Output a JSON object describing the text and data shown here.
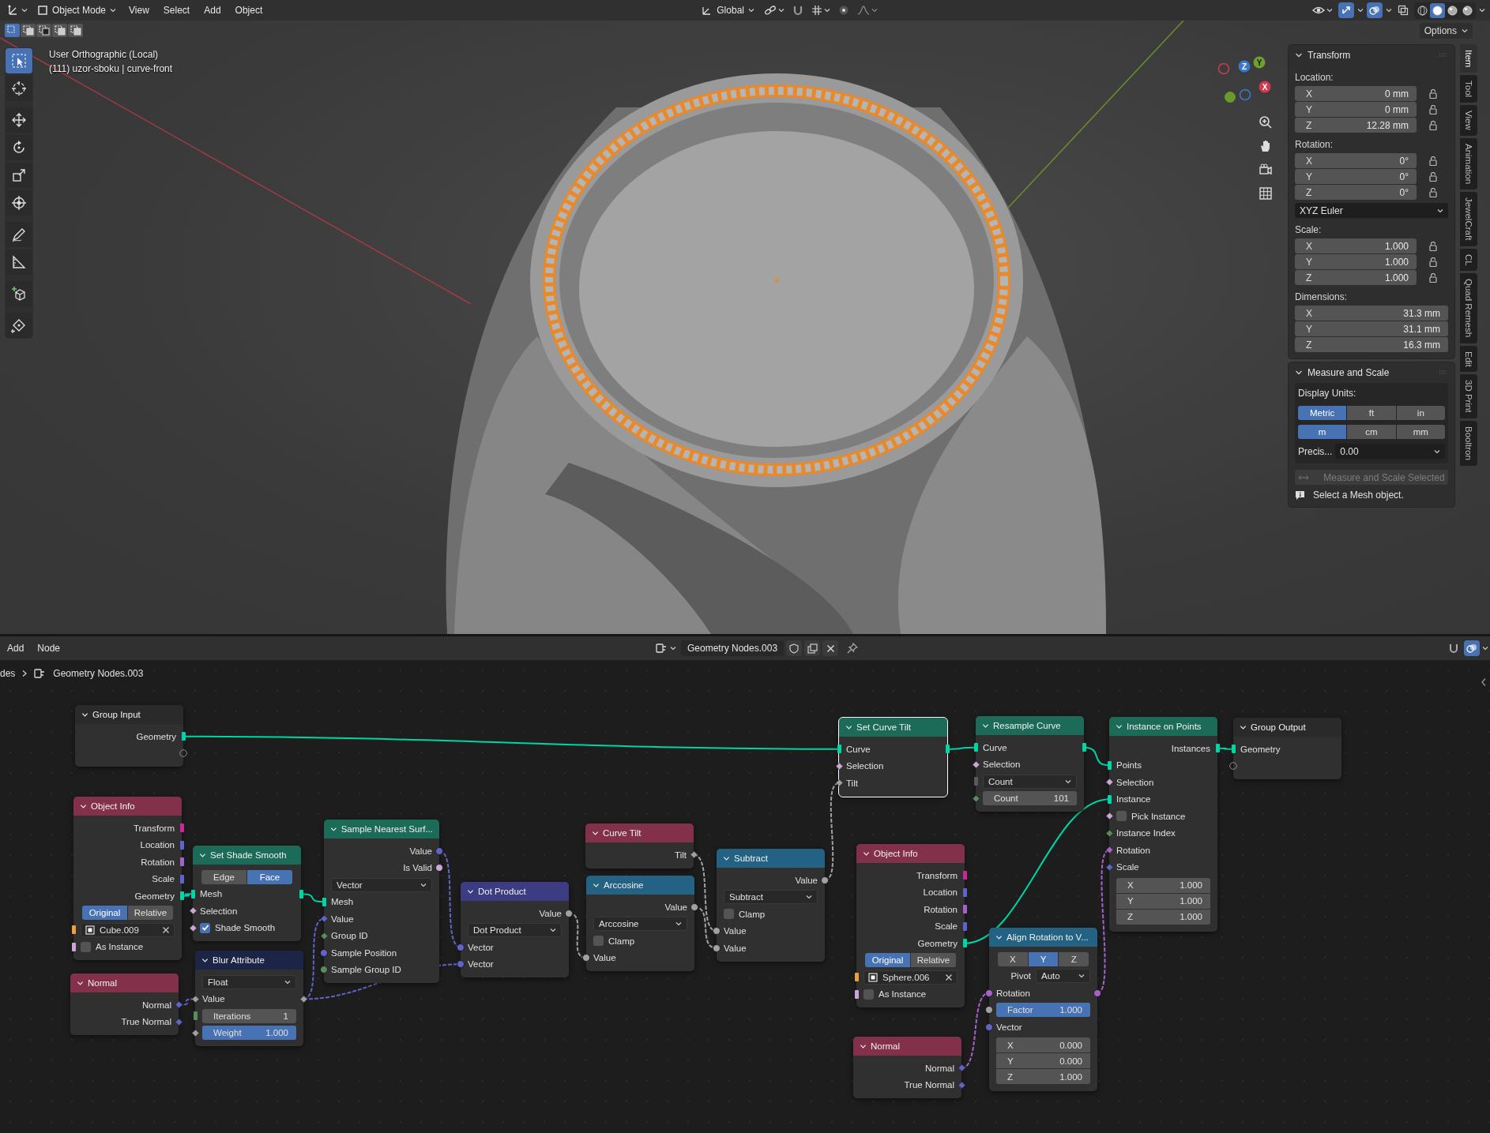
{
  "header": {
    "mode": "Object Mode",
    "menus": [
      "View",
      "Select",
      "Add",
      "Object"
    ],
    "orientation": "Global",
    "viewport_toggles": [
      {
        "kind": "gizmo",
        "on": true
      },
      {
        "kind": "overlay",
        "on": true
      },
      {
        "kind": "xray",
        "on": false
      }
    ],
    "shading": [
      {
        "kind": "wireframe",
        "selected": false
      },
      {
        "kind": "solid",
        "selected": true
      },
      {
        "kind": "material",
        "selected": false
      },
      {
        "kind": "rendered",
        "selected": false
      }
    ]
  },
  "viewport": {
    "select_modes": [
      {
        "kind": "set",
        "selected": true
      },
      {
        "kind": "extend",
        "selected": false
      },
      {
        "kind": "subtract",
        "selected": false
      },
      {
        "kind": "invert",
        "selected": false
      },
      {
        "kind": "intersect",
        "selected": false
      }
    ],
    "options": "Options",
    "view_name": "User Orthographic (Local)",
    "object_info": "(111) uzor-sboku | curve-front",
    "tools": [
      {
        "kind": "select",
        "selected": true
      },
      {
        "kind": "cursor",
        "selected": false
      },
      {
        "kind": "move",
        "selected": false
      },
      {
        "kind": "rotate",
        "selected": false
      },
      {
        "kind": "scale",
        "selected": false
      },
      {
        "kind": "transform",
        "selected": false
      },
      {
        "kind": "annotate",
        "selected": false
      },
      {
        "kind": "measure",
        "selected": false
      },
      {
        "kind": "add-cube",
        "selected": false
      },
      {
        "kind": "pen",
        "selected": false
      }
    ],
    "gizmo": {
      "x": "X",
      "y": "Y",
      "z": "Z"
    }
  },
  "sidebar": {
    "tabs": [
      {
        "label": "Item",
        "selected": true
      },
      {
        "label": "Tool",
        "selected": false
      },
      {
        "label": "View",
        "selected": false
      },
      {
        "label": "Animation",
        "selected": false
      },
      {
        "label": "JewelCraft",
        "selected": false
      },
      {
        "label": "CL",
        "selected": false
      },
      {
        "label": "Quad Remesh",
        "selected": false
      },
      {
        "label": "Edit",
        "selected": false
      },
      {
        "label": "3D Print",
        "selected": false
      },
      {
        "label": "Booltron",
        "selected": false
      }
    ],
    "transform": {
      "title": "Transform",
      "sections": [
        {
          "label": "Location:",
          "rows": [
            {
              "axis": "X",
              "value": "0 mm",
              "locked": false
            },
            {
              "axis": "Y",
              "value": "0 mm",
              "locked": false
            },
            {
              "axis": "Z",
              "value": "12.28 mm",
              "locked": false
            }
          ]
        },
        {
          "label": "Rotation:",
          "rows": [
            {
              "axis": "X",
              "value": "0°",
              "locked": false
            },
            {
              "axis": "Y",
              "value": "0°",
              "locked": false
            },
            {
              "axis": "Z",
              "value": "0°",
              "locked": false
            }
          ],
          "mode": "XYZ Euler"
        },
        {
          "label": "Scale:",
          "rows": [
            {
              "axis": "X",
              "value": "1.000",
              "locked": false
            },
            {
              "axis": "Y",
              "value": "1.000",
              "locked": false
            },
            {
              "axis": "Z",
              "value": "1.000",
              "locked": false
            }
          ]
        },
        {
          "label": "Dimensions:",
          "rows": [
            {
              "axis": "X",
              "value": "31.3 mm"
            },
            {
              "axis": "Y",
              "value": "31.1 mm"
            },
            {
              "axis": "Z",
              "value": "16.3 mm"
            }
          ]
        }
      ]
    },
    "measure": {
      "title": "Measure and Scale",
      "units_label": "Display Units:",
      "systems": [
        {
          "label": "Metric",
          "selected": true
        },
        {
          "label": "ft",
          "selected": false
        },
        {
          "label": "in",
          "selected": false
        }
      ],
      "units": [
        {
          "label": "m",
          "selected": true
        },
        {
          "label": "cm",
          "selected": false
        },
        {
          "label": "mm",
          "selected": false
        }
      ],
      "precision_label": "Precis...",
      "precision": "0.00",
      "button": {
        "label": "Measure and Scale Selected",
        "disabled": true
      },
      "message": "Select a Mesh object."
    }
  },
  "editor": {
    "menus": [
      "Add",
      "Node"
    ],
    "tree_name": "Geometry Nodes.003",
    "breadcrumb": [
      "des",
      "Geometry Nodes.003"
    ],
    "toggles": [
      {
        "kind": "snap",
        "on": false
      },
      {
        "kind": "overlay",
        "on": true
      }
    ],
    "nodes": [
      {
        "title": "Group Input",
        "color": "#2a2a2a",
        "selected": false,
        "rows": [
          {
            "kind": "out",
            "label": "Geometry",
            "socket": {
              "kind": "square",
              "color": "#00d6a3"
            }
          },
          {
            "kind": "virtual_out"
          }
        ]
      },
      {
        "title": "Object Info",
        "color": "#83314a",
        "selected": false,
        "rows": [
          {
            "kind": "out",
            "label": "Transform",
            "socket": {
              "kind": "square",
              "color": "#c7299b"
            }
          },
          {
            "kind": "out",
            "label": "Location",
            "socket": {
              "kind": "square",
              "color": "#6363c7"
            }
          },
          {
            "kind": "out",
            "label": "Rotation",
            "socket": {
              "kind": "square",
              "color": "#a663c7"
            }
          },
          {
            "kind": "out",
            "label": "Scale",
            "socket": {
              "kind": "square",
              "color": "#6363c7"
            }
          },
          {
            "kind": "out",
            "label": "Geometry",
            "socket": {
              "kind": "square",
              "color": "#00d6a3"
            }
          },
          {
            "kind": "toggle",
            "options": [
              {
                "label": "Original",
                "selected": true
              },
              {
                "label": "Relative",
                "selected": false
              }
            ]
          },
          {
            "kind": "object",
            "value": "Cube.009",
            "socket": {
              "kind": "square",
              "color": "#ed9e40"
            }
          },
          {
            "kind": "check",
            "label": "As Instance",
            "checked": false,
            "socket": {
              "kind": "square",
              "color": "#cca6d6"
            }
          }
        ]
      },
      {
        "title": "Normal",
        "color": "#83314a",
        "selected": false,
        "rows": [
          {
            "kind": "out",
            "label": "Normal",
            "socket": {
              "kind": "diamond",
              "color": "#6363c7"
            }
          },
          {
            "kind": "out",
            "label": "True Normal",
            "socket": {
              "kind": "diamond",
              "color": "#6363c7"
            }
          }
        ]
      },
      {
        "title": "Set Shade Smooth",
        "color": "#1b6b58",
        "selected": false,
        "rows": [
          {
            "kind": "toggle",
            "options": [
              {
                "label": "Edge",
                "selected": false
              },
              {
                "label": "Face",
                "selected": true
              }
            ]
          },
          {
            "kind": "inout",
            "label": "Mesh",
            "socket": {
              "kind": "square",
              "color": "#00d6a3"
            }
          },
          {
            "kind": "in",
            "label": "Selection",
            "socket": {
              "kind": "diamond",
              "color": "#cca6d6"
            }
          },
          {
            "kind": "check",
            "label": "Shade Smooth",
            "checked": true,
            "socket": {
              "kind": "diamond",
              "color": "#cca6d6"
            }
          }
        ]
      },
      {
        "title": "Blur Attribute",
        "color": "#1d2546",
        "selected": false,
        "rows": [
          {
            "kind": "dropdown",
            "value": "Float"
          },
          {
            "kind": "inout",
            "label": "Value",
            "socket": {
              "kind": "diamond",
              "color": "#a1a1a1"
            }
          },
          {
            "kind": "field",
            "label": "Iterations",
            "value": "1",
            "socket": {
              "kind": "square",
              "color": "#598c5c"
            }
          },
          {
            "kind": "field",
            "label": "Weight",
            "value": "1.000",
            "socket": {
              "kind": "diamond",
              "color": "#a1a1a1"
            },
            "level": 1
          }
        ]
      },
      {
        "title": "Sample Nearest Surf...",
        "color": "#1b6b58",
        "selected": false,
        "rows": [
          {
            "kind": "out",
            "label": "Value",
            "socket": {
              "kind": "dot",
              "color": "#6363c7"
            }
          },
          {
            "kind": "out",
            "label": "Is Valid",
            "socket": {
              "kind": "dot",
              "color": "#cca6d6"
            }
          },
          {
            "kind": "dropdown",
            "value": "Vector"
          },
          {
            "kind": "in",
            "label": "Mesh",
            "socket": {
              "kind": "square",
              "color": "#00d6a3"
            }
          },
          {
            "kind": "in",
            "label": "Value",
            "socket": {
              "kind": "diamond",
              "color": "#6363c7"
            }
          },
          {
            "kind": "in",
            "label": "Group ID",
            "socket": {
              "kind": "diamond",
              "color": "#598c5c"
            }
          },
          {
            "kind": "in",
            "label": "Sample Position",
            "socket": {
              "kind": "dot",
              "color": "#6363c7"
            }
          },
          {
            "kind": "in",
            "label": "Sample Group ID",
            "socket": {
              "kind": "dot",
              "color": "#598c5c"
            }
          }
        ]
      },
      {
        "title": "Dot Product",
        "color": "#3c3c83",
        "selected": false,
        "rows": [
          {
            "kind": "out",
            "label": "Value",
            "socket": {
              "kind": "dot",
              "color": "#a1a1a1"
            }
          },
          {
            "kind": "dropdown",
            "value": "Dot Product"
          },
          {
            "kind": "in",
            "label": "Vector",
            "socket": {
              "kind": "dot",
              "color": "#6363c7"
            }
          },
          {
            "kind": "in",
            "label": "Vector",
            "socket": {
              "kind": "dot",
              "color": "#6363c7"
            }
          }
        ]
      },
      {
        "title": "Curve Tilt",
        "color": "#83314a",
        "selected": false,
        "rows": [
          {
            "kind": "out",
            "label": "Tilt",
            "socket": {
              "kind": "diamond",
              "color": "#a1a1a1"
            }
          }
        ]
      },
      {
        "title": "Arccosine",
        "color": "#246283",
        "selected": false,
        "rows": [
          {
            "kind": "out",
            "label": "Value",
            "socket": {
              "kind": "dot",
              "color": "#a1a1a1"
            }
          },
          {
            "kind": "dropdown",
            "value": "Arccosine"
          },
          {
            "kind": "check",
            "label": "Clamp",
            "checked": false
          },
          {
            "kind": "in",
            "label": "Value",
            "socket": {
              "kind": "dot",
              "color": "#a1a1a1"
            }
          }
        ]
      },
      {
        "title": "Subtract",
        "color": "#246283",
        "selected": false,
        "rows": [
          {
            "kind": "out",
            "label": "Value",
            "socket": {
              "kind": "dot",
              "color": "#a1a1a1"
            }
          },
          {
            "kind": "dropdown",
            "value": "Subtract"
          },
          {
            "kind": "check",
            "label": "Clamp",
            "checked": false
          },
          {
            "kind": "in",
            "label": "Value",
            "socket": {
              "kind": "dot",
              "color": "#a1a1a1"
            }
          },
          {
            "kind": "in",
            "label": "Value",
            "socket": {
              "kind": "dot",
              "color": "#a1a1a1"
            }
          }
        ]
      },
      {
        "title": "Set Curve Tilt",
        "color": "#1b6b58",
        "selected": true,
        "rows": [
          {
            "kind": "inout",
            "label": "Curve",
            "socket": {
              "kind": "square",
              "color": "#00d6a3"
            }
          },
          {
            "kind": "in",
            "label": "Selection",
            "socket": {
              "kind": "diamond",
              "color": "#cca6d6"
            }
          },
          {
            "kind": "in",
            "label": "Tilt",
            "socket": {
              "kind": "diamond",
              "color": "#a1a1a1"
            }
          }
        ]
      },
      {
        "title": "Resample Curve",
        "color": "#1b6b58",
        "selected": false,
        "rows": [
          {
            "kind": "inout",
            "label": "Curve",
            "socket": {
              "kind": "square",
              "color": "#00d6a3"
            }
          },
          {
            "kind": "in",
            "label": "Selection",
            "socket": {
              "kind": "diamond",
              "color": "#cca6d6"
            }
          },
          {
            "kind": "dropdown",
            "value": "Count",
            "socket": {
              "kind": "square",
              "color": "#5a5a5a"
            }
          },
          {
            "kind": "field",
            "label": "Count",
            "value": "101",
            "socket": {
              "kind": "diamond",
              "color": "#598c5c"
            }
          }
        ]
      },
      {
        "title": "Instance on Points",
        "color": "#1b6b58",
        "selected": false,
        "rows": [
          {
            "kind": "out",
            "label": "Instances",
            "socket": {
              "kind": "square",
              "color": "#00d6a3"
            }
          },
          {
            "kind": "in",
            "label": "Points",
            "socket": {
              "kind": "square",
              "color": "#00d6a3"
            }
          },
          {
            "kind": "in",
            "label": "Selection",
            "socket": {
              "kind": "diamond",
              "color": "#cca6d6"
            }
          },
          {
            "kind": "in",
            "label": "Instance",
            "socket": {
              "kind": "square",
              "color": "#00d6a3"
            }
          },
          {
            "kind": "check",
            "label": "Pick Instance",
            "checked": false,
            "socket": {
              "kind": "diamond",
              "color": "#cca6d6"
            }
          },
          {
            "kind": "in",
            "label": "Instance Index",
            "socket": {
              "kind": "diamond",
              "color": "#598c5c"
            }
          },
          {
            "kind": "in",
            "label": "Rotation",
            "socket": {
              "kind": "diamond",
              "color": "#a663c7"
            }
          },
          {
            "kind": "in",
            "label": "Scale",
            "socket": {
              "kind": "diamond",
              "color": "#6363c7"
            }
          },
          {
            "kind": "vector",
            "axes": [
              {
                "axis": "X",
                "value": "1.000"
              },
              {
                "axis": "Y",
                "value": "1.000"
              },
              {
                "axis": "Z",
                "value": "1.000"
              }
            ]
          }
        ]
      },
      {
        "title": "Group Output",
        "color": "#2a2a2a",
        "selected": false,
        "rows": [
          {
            "kind": "in",
            "label": "Geometry",
            "socket": {
              "kind": "square",
              "color": "#00d6a3"
            }
          },
          {
            "kind": "virtual_in"
          }
        ]
      },
      {
        "title": "Object Info",
        "color": "#83314a",
        "selected": false,
        "rows": [
          {
            "kind": "out",
            "label": "Transform",
            "socket": {
              "kind": "square",
              "color": "#c7299b"
            }
          },
          {
            "kind": "out",
            "label": "Location",
            "socket": {
              "kind": "square",
              "color": "#6363c7"
            }
          },
          {
            "kind": "out",
            "label": "Rotation",
            "socket": {
              "kind": "square",
              "color": "#a663c7"
            }
          },
          {
            "kind": "out",
            "label": "Scale",
            "socket": {
              "kind": "square",
              "color": "#6363c7"
            }
          },
          {
            "kind": "out",
            "label": "Geometry",
            "socket": {
              "kind": "square",
              "color": "#00d6a3"
            }
          },
          {
            "kind": "toggle",
            "options": [
              {
                "label": "Original",
                "selected": true
              },
              {
                "label": "Relative",
                "selected": false
              }
            ]
          },
          {
            "kind": "object",
            "value": "Sphere.006",
            "socket": {
              "kind": "square",
              "color": "#ed9e40"
            }
          },
          {
            "kind": "check",
            "label": "As Instance",
            "checked": false,
            "socket": {
              "kind": "square",
              "color": "#cca6d6"
            }
          }
        ]
      },
      {
        "title": "Align Rotation to V...",
        "color": "#246283",
        "selected": false,
        "rows": [
          {
            "kind": "toggle",
            "options": [
              {
                "label": "X",
                "selected": false
              },
              {
                "label": "Y",
                "selected": true
              },
              {
                "label": "Z",
                "selected": false
              }
            ]
          },
          {
            "kind": "labeled_dropdown",
            "label": "Pivot",
            "value": "Auto"
          },
          {
            "kind": "inout",
            "label": "Rotation",
            "socket": {
              "kind": "dot",
              "color": "#a663c7"
            }
          },
          {
            "kind": "field",
            "label": "Factor",
            "value": "1.000",
            "socket": {
              "kind": "dot",
              "color": "#a1a1a1"
            },
            "level": 1
          },
          {
            "kind": "in",
            "label": "Vector",
            "socket": {
              "kind": "dot",
              "color": "#6363c7"
            }
          },
          {
            "kind": "vector",
            "axes": [
              {
                "axis": "X",
                "value": "0.000"
              },
              {
                "axis": "Y",
                "value": "0.000"
              },
              {
                "axis": "Z",
                "value": "1.000"
              }
            ]
          }
        ]
      },
      {
        "title": "Normal",
        "color": "#83314a",
        "selected": false,
        "rows": [
          {
            "kind": "out",
            "label": "Normal",
            "socket": {
              "kind": "diamond",
              "color": "#6363c7"
            }
          },
          {
            "kind": "out",
            "label": "True Normal",
            "socket": {
              "kind": "diamond",
              "color": "#6363c7"
            }
          }
        ]
      }
    ]
  }
}
